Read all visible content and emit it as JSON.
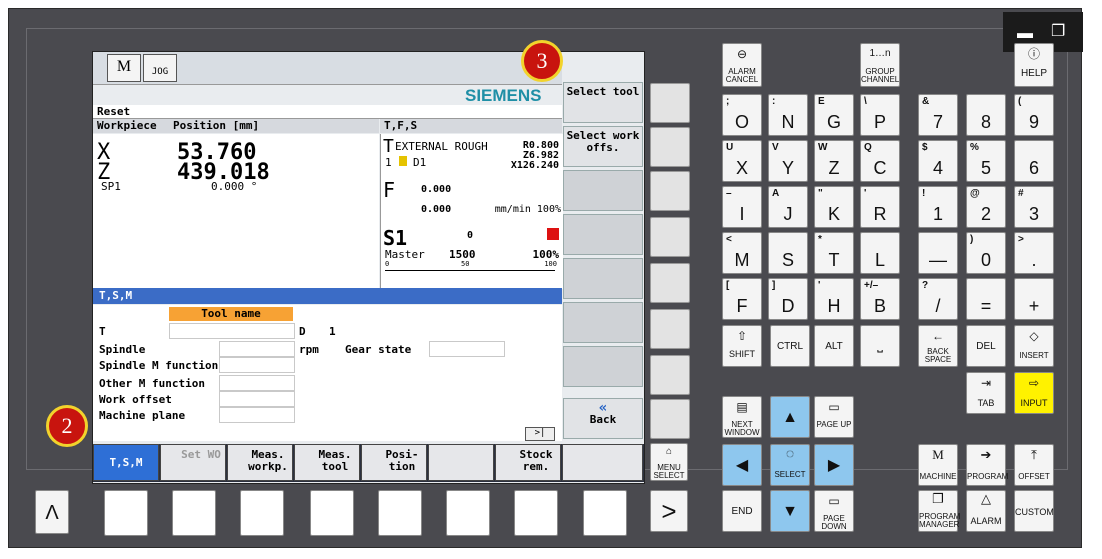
{
  "window_controls": {
    "minimize": "▬",
    "restore": "❐"
  },
  "screen": {
    "brand": "SIEMENS",
    "mode_icons": [
      "M",
      "JOG"
    ],
    "reset_label": "Reset",
    "workpiece_header": "Workpiece",
    "position_header": "Position [mm]",
    "tfs_header": "T,F,S",
    "axes": [
      {
        "name": "X",
        "value": "53.760"
      },
      {
        "name": "Z",
        "value": "439.018"
      }
    ],
    "spindle_label": "SP1",
    "spindle_pos": "0.000 °",
    "tool_name": "EXTERNAL ROUGH",
    "tool_num": "1",
    "tool_d": "D1",
    "tool_r": "R0.800",
    "tool_z": "Z6.982",
    "tool_x": "X126.240",
    "feed_label": "F",
    "feed_val1": "0.000",
    "feed_val2": "0.000",
    "feed_unit": "mm/min 100%",
    "s1_label": "S1",
    "s1_val": "0",
    "master_label": "Master",
    "master_val": "1500",
    "master_pct": "100%",
    "scale_0": "0",
    "scale_50": "50",
    "scale_100": "100",
    "tsm_title": "T,S,M",
    "tool_name_header": "Tool name",
    "row_t": "T",
    "row_d": "D",
    "row_d_val": "1",
    "row_spindle": "Spindle",
    "row_rpm": "rpm",
    "row_gear": "Gear state",
    "row_spindle_m": "Spindle M function",
    "row_other_m": "Other M function",
    "row_work_offset": "Work offset",
    "row_machine_plane": "Machine plane",
    "scroll_arrow": ">|"
  },
  "softkeys_vertical": [
    {
      "label": "Select tool"
    },
    {
      "label": "Select work offs."
    },
    {
      "label": ""
    },
    {
      "label": ""
    },
    {
      "label": ""
    },
    {
      "label": ""
    },
    {
      "label": ""
    },
    {
      "label": "Back"
    }
  ],
  "softkeys_horizontal": [
    {
      "label": "T,S,M"
    },
    {
      "label": "Set WO"
    },
    {
      "label": "Meas. workp."
    },
    {
      "label": "Meas. tool"
    },
    {
      "label": "Posi- tion"
    },
    {
      "label": ""
    },
    {
      "label": "Stock rem."
    },
    {
      "label": ""
    }
  ],
  "badges": {
    "three": "3",
    "two": "2"
  },
  "keys": {
    "alarm_cancel": "ALARM CANCEL",
    "group_channel": "GROUP CHANNEL",
    "help": "HELP",
    "letters": [
      {
        "sm": ";",
        "big": "O"
      },
      {
        "sm": ":",
        "big": "N"
      },
      {
        "sm": "E",
        "big": "G"
      },
      {
        "sm": "\\",
        "big": "P"
      },
      {
        "sm": "U",
        "big": "X"
      },
      {
        "sm": "V",
        "big": "Y"
      },
      {
        "sm": "W",
        "big": "Z"
      },
      {
        "sm": "Q",
        "big": "C"
      },
      {
        "sm": "–",
        "big": "I"
      },
      {
        "sm": "A",
        "big": "J"
      },
      {
        "sm": "\"",
        "big": "K"
      },
      {
        "sm": "'",
        "big": "R"
      },
      {
        "sm": "<",
        "big": "M"
      },
      {
        "sm": "",
        "big": "S"
      },
      {
        "sm": "*",
        "big": "T"
      },
      {
        "sm": "",
        "big": "L"
      },
      {
        "sm": "[",
        "big": "F"
      },
      {
        "sm": "]",
        "big": "D"
      },
      {
        "sm": "'",
        "big": "H"
      },
      {
        "sm": "+/–",
        "big": "B"
      }
    ],
    "numbers": [
      {
        "sm": "&",
        "big": "7"
      },
      {
        "sm": "",
        "big": "8"
      },
      {
        "sm": "(",
        "big": "9"
      },
      {
        "sm": "$",
        "big": "4"
      },
      {
        "sm": "%",
        "big": "5"
      },
      {
        "sm": "",
        "big": "6"
      },
      {
        "sm": "!",
        "big": "1"
      },
      {
        "sm": "@",
        "big": "2"
      },
      {
        "sm": "#",
        "big": "3"
      },
      {
        "sm": "",
        "big": "—"
      },
      {
        "sm": ")",
        "big": "0"
      },
      {
        "sm": ">",
        "big": "."
      },
      {
        "sm": "?",
        "big": "/"
      },
      {
        "sm": "",
        "big": "="
      },
      {
        "sm": "",
        "big": "+"
      }
    ],
    "shift": "SHIFT",
    "ctrl": "CTRL",
    "alt": "ALT",
    "backspace": "BACK SPACE",
    "del": "DEL",
    "insert": "INSERT",
    "tab": "TAB",
    "input": "INPUT",
    "next_window": "NEXT WINDOW",
    "page_up": "PAGE UP",
    "select": "SELECT",
    "end": "END",
    "page_down": "PAGE DOWN",
    "menu_select": "MENU SELECT",
    "machine": "MACHINE",
    "program": "PROGRAM",
    "offset": "OFFSET",
    "program_manager": "PROGRAM MANAGER",
    "alarm": "ALARM",
    "custom": "CUSTOM",
    "recall": "Λ",
    "next": ">"
  }
}
